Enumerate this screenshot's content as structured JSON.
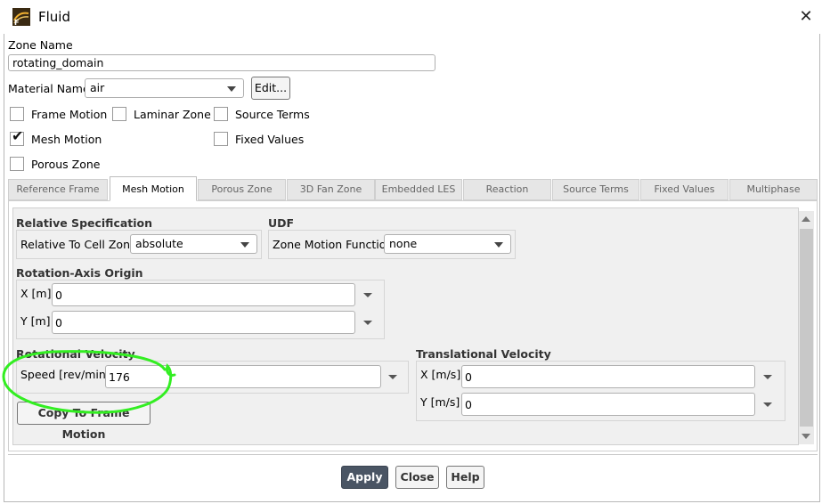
{
  "window": {
    "title": "Fluid",
    "icon": "fluent-app-icon"
  },
  "zone_name": {
    "label": "Zone Name",
    "value": "rotating_domain"
  },
  "material": {
    "label": "Material Name",
    "value": "air",
    "edit_label": "Edit..."
  },
  "checkboxes": [
    {
      "label": "Frame Motion",
      "checked": false
    },
    {
      "label": "Laminar Zone",
      "checked": false
    },
    {
      "label": "Source Terms",
      "checked": false
    },
    {
      "label": "Mesh Motion",
      "checked": true
    },
    {
      "label": "Fixed Values",
      "checked": false
    },
    {
      "label": "Porous Zone",
      "checked": false
    }
  ],
  "tabs": [
    "Reference Frame",
    "Mesh Motion",
    "Porous Zone",
    "3D Fan Zone",
    "Embedded LES",
    "Reaction",
    "Source Terms",
    "Fixed Values",
    "Multiphase"
  ],
  "active_tab": "Mesh Motion",
  "relative_spec": {
    "header": "Relative Specification",
    "label": "Relative To Cell Zone",
    "value": "absolute"
  },
  "udf": {
    "header": "UDF",
    "label": "Zone Motion Function",
    "value": "none"
  },
  "origin": {
    "header": "Rotation-Axis Origin",
    "x_label": "X [m]",
    "x_value": "0",
    "y_label": "Y [m]",
    "y_value": "0"
  },
  "rotational": {
    "header": "Rotational Velocity",
    "speed_label": "Speed [rev/min]",
    "speed_value": "176",
    "copy_label": "Copy To Frame Motion"
  },
  "translational": {
    "header": "Translational Velocity",
    "x_label": "X [m/s]",
    "x_value": "0",
    "y_label": "Y [m/s]",
    "y_value": "0"
  },
  "buttons": {
    "apply": "Apply",
    "close": "Close",
    "help": "Help"
  },
  "colors": {
    "annotation": "#33ee22",
    "apply_bg": "#4a5564"
  }
}
